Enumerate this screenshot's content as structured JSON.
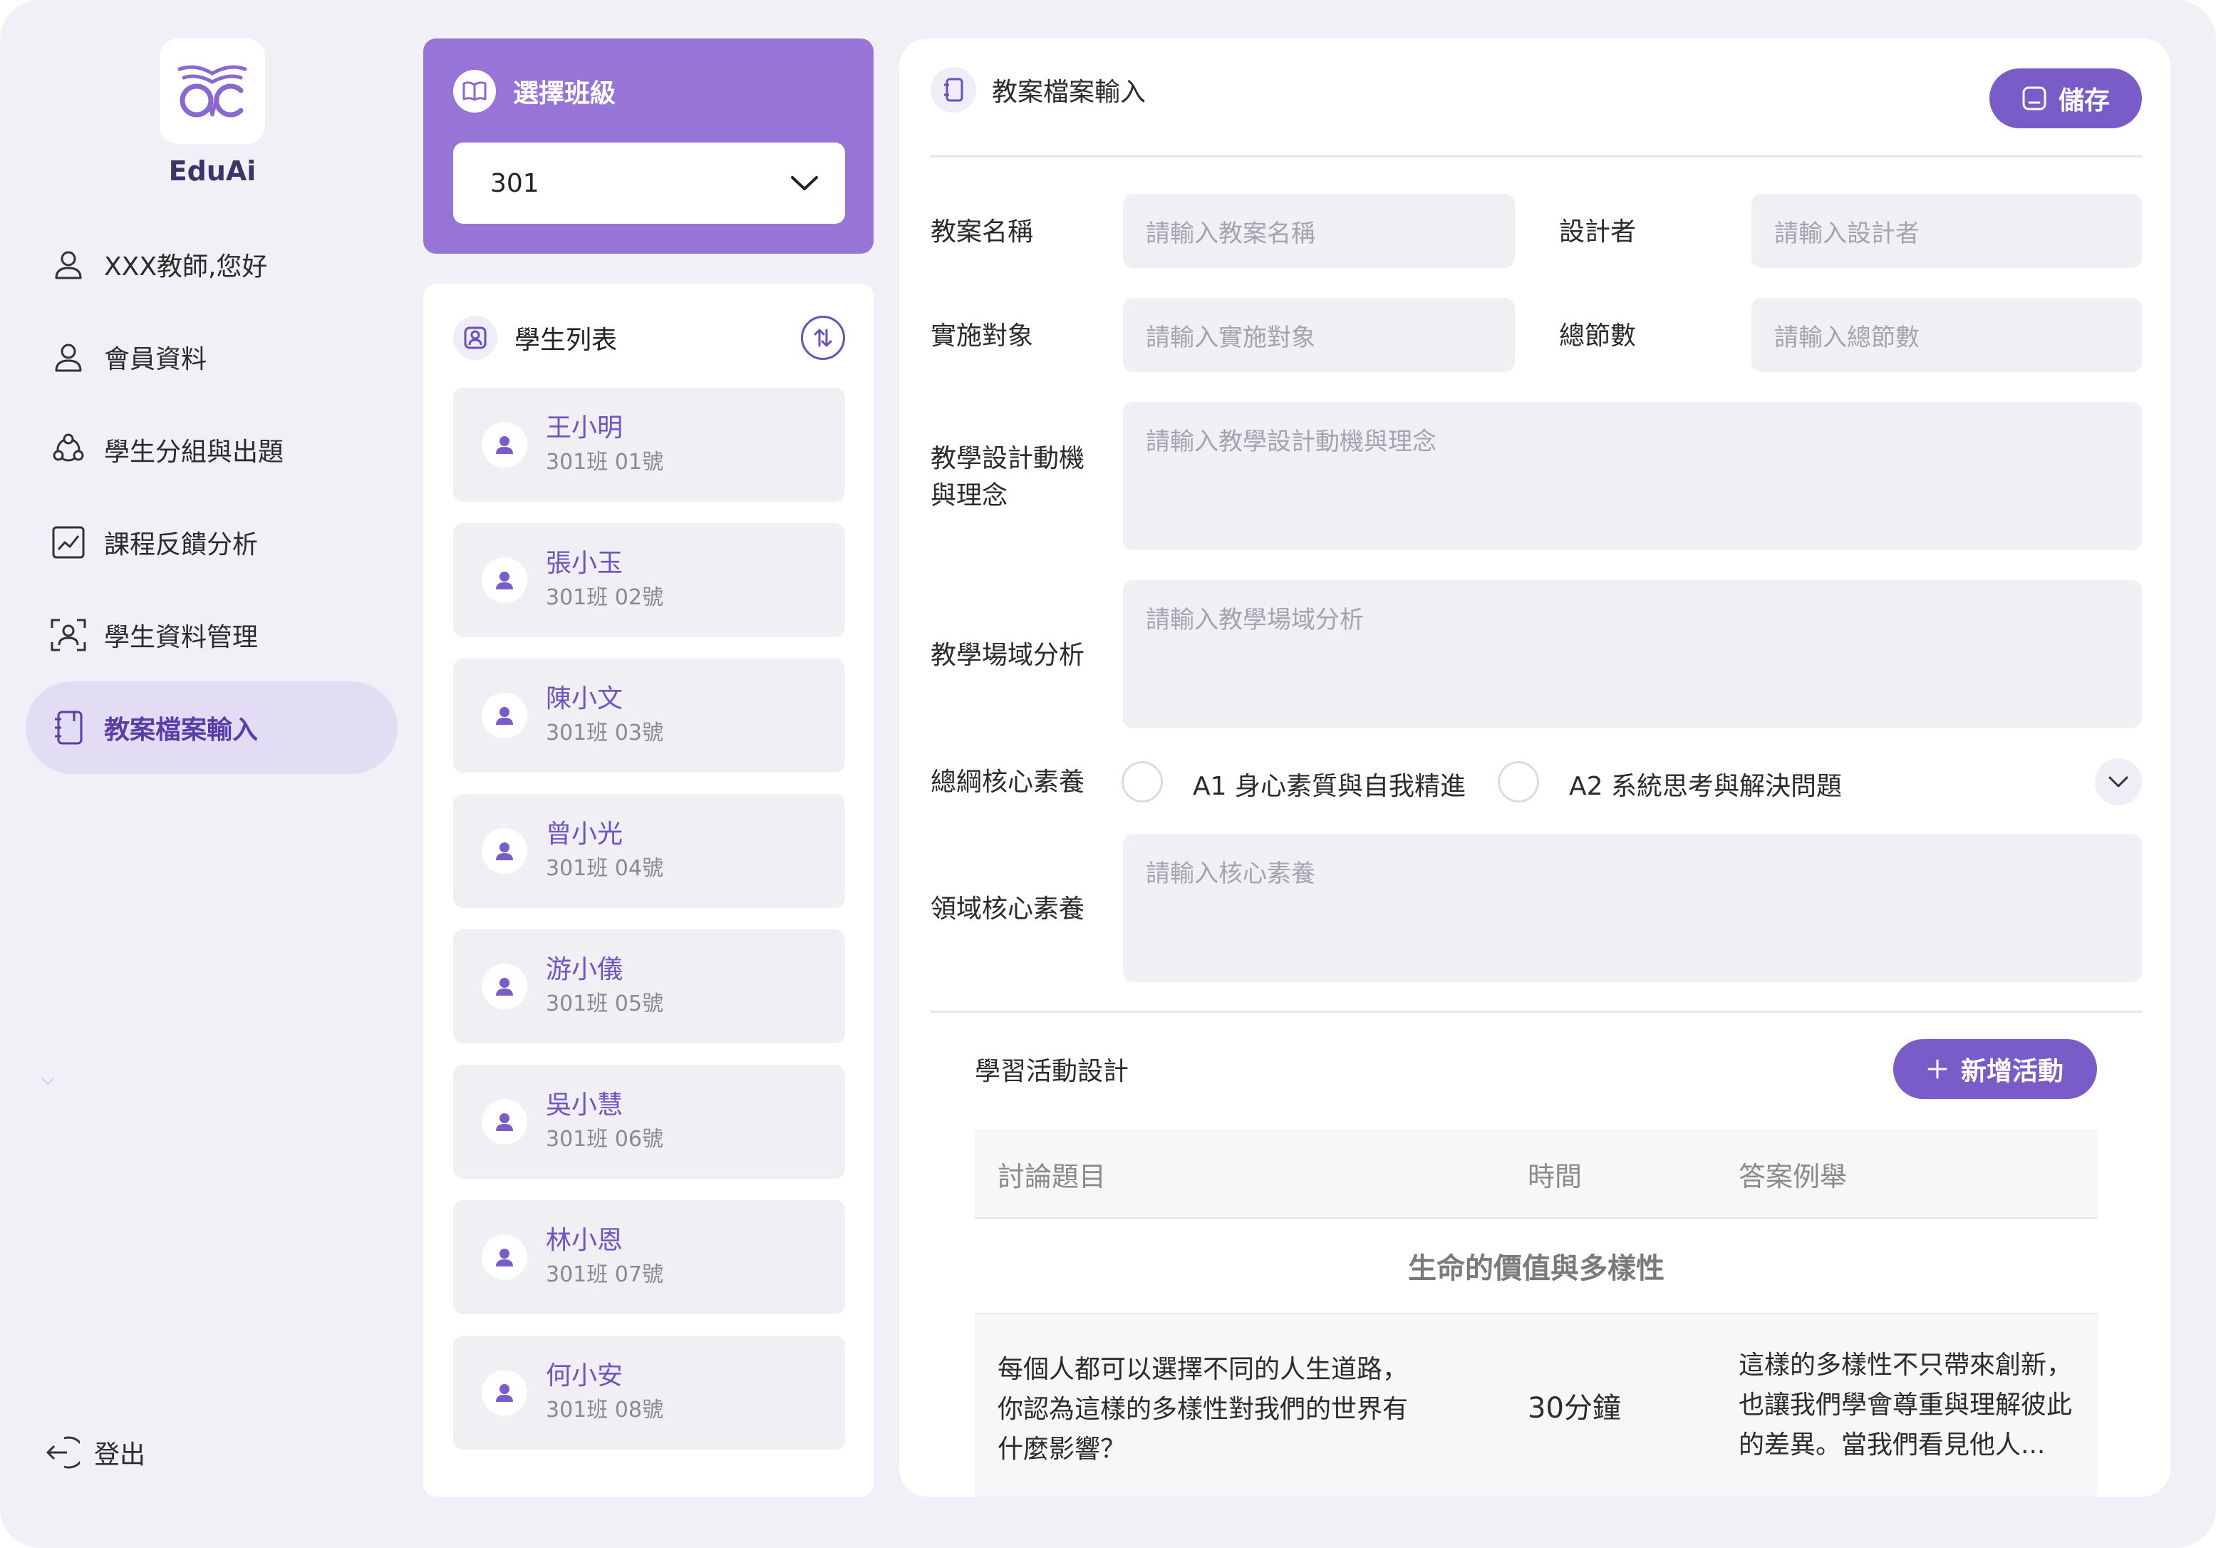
{
  "app": {
    "brand": "EduAi"
  },
  "nav": {
    "items": [
      {
        "label": "XXX教師,您好",
        "icon": "user-icon"
      },
      {
        "label": "會員資料",
        "icon": "user-icon"
      },
      {
        "label": "學生分組與出題",
        "icon": "group-icon"
      },
      {
        "label": "課程反饋分析",
        "icon": "chart-icon"
      },
      {
        "label": "學生資料管理",
        "icon": "face-scan-icon"
      },
      {
        "label": "教案檔案輸入",
        "icon": "notebook-icon",
        "active": true
      }
    ],
    "logout": "登出"
  },
  "class_select": {
    "title": "選擇班級",
    "value": "301"
  },
  "student_list": {
    "title": "學生列表",
    "students": [
      {
        "name": "王小明",
        "info": "301班 01號"
      },
      {
        "name": "張小玉",
        "info": "301班 02號"
      },
      {
        "name": "陳小文",
        "info": "301班 03號"
      },
      {
        "name": "曾小光",
        "info": "301班 04號"
      },
      {
        "name": "游小儀",
        "info": "301班 05號"
      },
      {
        "name": "吳小慧",
        "info": "301班 06號"
      },
      {
        "name": "林小恩",
        "info": "301班 07號"
      },
      {
        "name": "何小安",
        "info": "301班 08號"
      }
    ]
  },
  "form": {
    "title": "教案檔案輸入",
    "save": "儲存",
    "fields": {
      "plan_name": {
        "label": "教案名稱",
        "placeholder": "請輸入教案名稱"
      },
      "designer": {
        "label": "設計者",
        "placeholder": "請輸入設計者"
      },
      "target": {
        "label": "實施對象",
        "placeholder": "請輸入實施對象"
      },
      "sessions": {
        "label": "總節數",
        "placeholder": "請輸入總節數"
      },
      "motivation": {
        "label_line1": "教學設計動機",
        "label_line2": "與理念",
        "placeholder": "請輸入教學設計動機與理念"
      },
      "field_analysis": {
        "label": "教學場域分析",
        "placeholder": "請輸入教學場域分析"
      },
      "core_competency": {
        "label": "總綱核心素養",
        "options": [
          "A1 身心素質與自我精進",
          "A2 系統思考與解決問題"
        ]
      },
      "domain_competency": {
        "label": "領域核心素養",
        "placeholder": "請輸入核心素養"
      }
    }
  },
  "activities": {
    "title": "學習活動設計",
    "add": "新增活動",
    "columns": [
      "討論題目",
      "時間",
      "答案例舉"
    ],
    "section": "生命的價值與多樣性",
    "rows": [
      {
        "topic": [
          "每個人都可以選擇不同的人生道路，",
          "你認為這樣的多樣性對我們的世界有",
          "什麼影響？"
        ],
        "time": "30分鐘",
        "answer": [
          "這樣的多樣性不只帶來創新，",
          "也讓我們學會尊重與理解彼此",
          "的差異。當我們看見他人..."
        ]
      }
    ]
  },
  "colors": {
    "accent": "#7a5cc8",
    "accent_light": "#9775d6",
    "nav_active_bg": "#e3dcf5",
    "frame_bg": "#f1f0f6"
  }
}
